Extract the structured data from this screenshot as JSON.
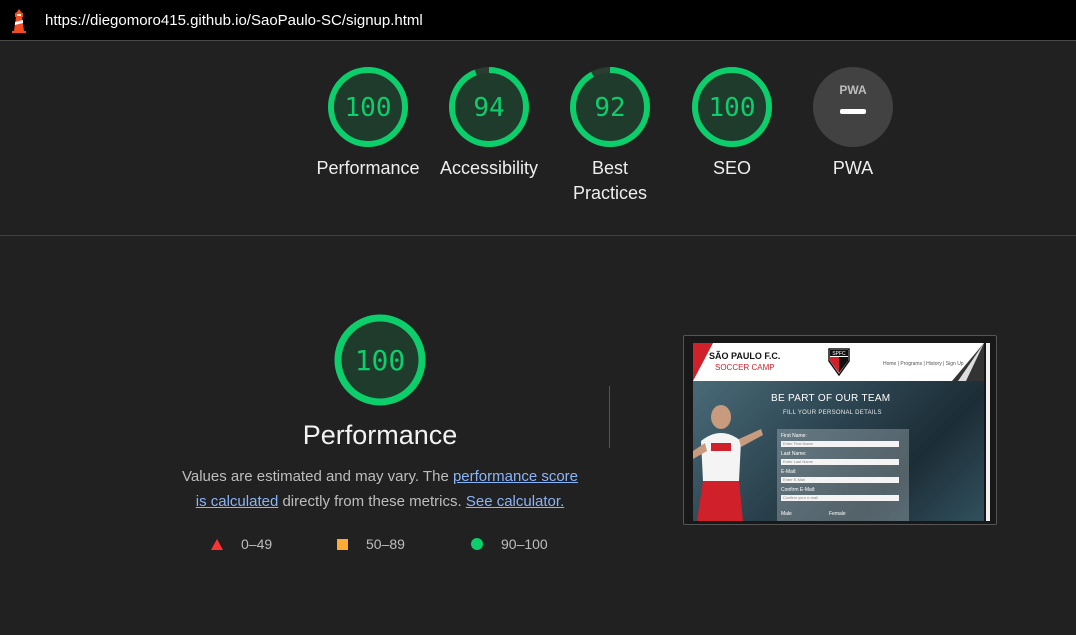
{
  "header": {
    "url": "https://diegomoro415.github.io/SaoPaulo-SC/signup.html",
    "icon": "lighthouse-icon"
  },
  "colors": {
    "pass": "#0cce6b",
    "average": "#ffaa33",
    "fail": "#ff3333",
    "background": "#212121",
    "link": "#8ab4f8"
  },
  "gauges": [
    {
      "label": "Performance",
      "score": 100
    },
    {
      "label": "Accessibility",
      "score": 94
    },
    {
      "label_line1": "Best",
      "label_line2": "Practices",
      "score": 92
    },
    {
      "label": "SEO",
      "score": 100
    },
    {
      "label": "PWA",
      "badge_text": "PWA"
    }
  ],
  "performance": {
    "score": 100,
    "title": "Performance",
    "desc_prefix": "Values are estimated and may vary. The ",
    "desc_link1_a": "performance score",
    "desc_link1_b": "is calculated",
    "desc_middle": " directly from these metrics. ",
    "desc_link2": "See calculator.",
    "legend": [
      {
        "icon": "triangle-icon",
        "range": "0–49"
      },
      {
        "icon": "square-icon",
        "range": "50–89"
      },
      {
        "icon": "circle-icon",
        "range": "90–100"
      }
    ]
  },
  "screenshot": {
    "brand_line1": "SÃO PAULO F.C.",
    "brand_line2": "SOCCER CAMP",
    "crest_text": "SPFC",
    "nav": "Home | Programs | History | Sign Up",
    "hero_title": "BE PART OF OUR TEAM",
    "hero_sub": "FILL YOUR PERSONAL DETAILS",
    "fields": [
      {
        "label": "First Name:",
        "placeholder": "Enter First Name"
      },
      {
        "label": "Last Name:",
        "placeholder": "Enter Last Name"
      },
      {
        "label": "E-Mail:",
        "placeholder": "Enter E-Mail"
      },
      {
        "label": "Confirm E-Mail:",
        "placeholder": "Confirm your e-mail"
      }
    ],
    "gender_male": "Male",
    "gender_female": "Female"
  }
}
